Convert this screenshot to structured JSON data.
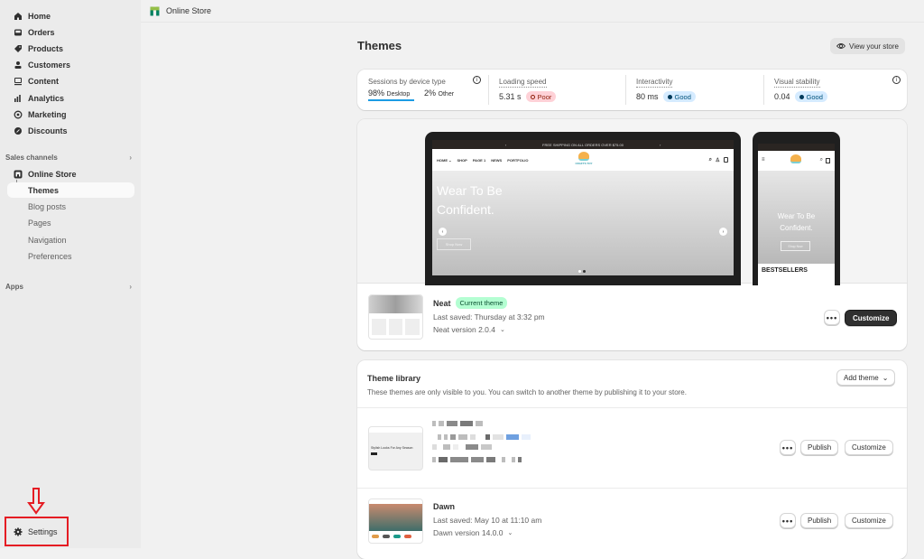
{
  "sidebar": {
    "items": [
      {
        "label": "Home",
        "icon": "home-icon"
      },
      {
        "label": "Orders",
        "icon": "inbox-icon"
      },
      {
        "label": "Products",
        "icon": "tag-icon"
      },
      {
        "label": "Customers",
        "icon": "person-icon"
      },
      {
        "label": "Content",
        "icon": "content-icon"
      },
      {
        "label": "Analytics",
        "icon": "bar-chart-icon"
      },
      {
        "label": "Marketing",
        "icon": "target-icon"
      },
      {
        "label": "Discounts",
        "icon": "discount-icon"
      }
    ],
    "sales_channels_label": "Sales channels",
    "online_store_label": "Online Store",
    "sub_items": [
      "Themes",
      "Blog posts",
      "Pages",
      "Navigation",
      "Preferences"
    ],
    "apps_label": "Apps",
    "settings_label": "Settings"
  },
  "topbar": {
    "title": "Online Store"
  },
  "page": {
    "title": "Themes",
    "view_store_label": "View your store"
  },
  "metrics": {
    "sessions": {
      "label": "Sessions by device type",
      "desktop_pct": "98%",
      "desktop_label": "Desktop",
      "other_pct": "2%",
      "other_label": "Other"
    },
    "loading": {
      "label": "Loading speed",
      "value": "5.31 s",
      "status": "Poor"
    },
    "interactivity": {
      "label": "Interactivity",
      "value": "80 ms",
      "status": "Good"
    },
    "stability": {
      "label": "Visual stability",
      "value": "0.04",
      "status": "Good"
    }
  },
  "preview": {
    "announcement": "FREE SHIPPING ON ALL ORDERS OVER $75.00",
    "nav": [
      "HOME ⌄",
      "SHOP",
      "PAGE 1",
      "NEWS",
      "PORTFOLIO"
    ],
    "logo_text": "CRAFTS TOY",
    "hero_line1": "Wear To Be",
    "hero_line2": "Confident.",
    "hero_button": "Shop Now",
    "mobile_heading": "BESTSELLERS"
  },
  "current_theme": {
    "name": "Neat",
    "badge": "Current theme",
    "last_saved": "Last saved: Thursday at 3:32 pm",
    "version": "Neat version 2.0.4",
    "more_label": "•••",
    "customize_label": "Customize"
  },
  "library": {
    "title": "Theme library",
    "description": "These themes are only visible to you. You can switch to another theme by publishing it to your store.",
    "add_theme_label": "Add theme",
    "themes": [
      {
        "name": "",
        "last_saved": "",
        "version": "",
        "blurred": true,
        "thumb_text": "Stylish Looks For Any Season",
        "publish_label": "Publish",
        "customize_label": "Customize",
        "more_label": "•••"
      },
      {
        "name": "Dawn",
        "last_saved": "Last saved: May 10 at 11:10 am",
        "version": "Dawn version 14.0.0",
        "blurred": false,
        "publish_label": "Publish",
        "customize_label": "Customize",
        "more_label": "•••"
      }
    ]
  },
  "colors": {
    "accent_highlight": "#e51c23",
    "poor_bg": "#fed1d7",
    "good_bg": "#d5ebff",
    "current_badge_bg": "#b4fed2"
  }
}
